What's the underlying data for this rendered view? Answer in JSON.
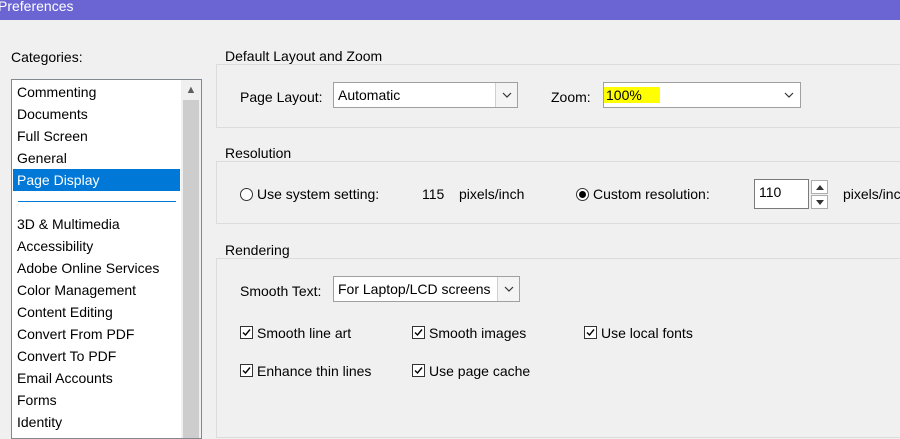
{
  "window": {
    "title": "Preferences"
  },
  "categories": {
    "label": "Categories:",
    "top_items": [
      "Commenting",
      "Documents",
      "Full Screen",
      "General",
      "Page Display"
    ],
    "selected": "Page Display",
    "items": [
      "3D & Multimedia",
      "Accessibility",
      "Adobe Online Services",
      "Color Management",
      "Content Editing",
      "Convert From PDF",
      "Convert To PDF",
      "Email Accounts",
      "Forms",
      "Identity"
    ]
  },
  "layout_zoom": {
    "title": "Default Layout and Zoom",
    "page_layout_label": "Page Layout:",
    "page_layout_value": "Automatic",
    "zoom_label": "Zoom:",
    "zoom_value": "100%"
  },
  "resolution": {
    "title": "Resolution",
    "system_label": "Use system setting:",
    "system_value": "115",
    "system_unit": "pixels/inch",
    "system_selected": false,
    "custom_label": "Custom resolution:",
    "custom_value": "110",
    "custom_unit": "pixels/inch",
    "custom_selected": true
  },
  "rendering": {
    "title": "Rendering",
    "smooth_text_label": "Smooth Text:",
    "smooth_text_value": "For Laptop/LCD screens",
    "checkboxes": {
      "smooth_line_art": {
        "label": "Smooth line art",
        "checked": true
      },
      "smooth_images": {
        "label": "Smooth images",
        "checked": true
      },
      "use_local_fonts": {
        "label": "Use local fonts",
        "checked": true
      },
      "enhance_thin_lines": {
        "label": "Enhance thin lines",
        "checked": true
      },
      "use_page_cache": {
        "label": "Use page cache",
        "checked": true
      }
    }
  },
  "colors": {
    "title_bar": "#6b65d4",
    "selection": "#0078d7",
    "zoom_highlight": "#ffff00"
  }
}
